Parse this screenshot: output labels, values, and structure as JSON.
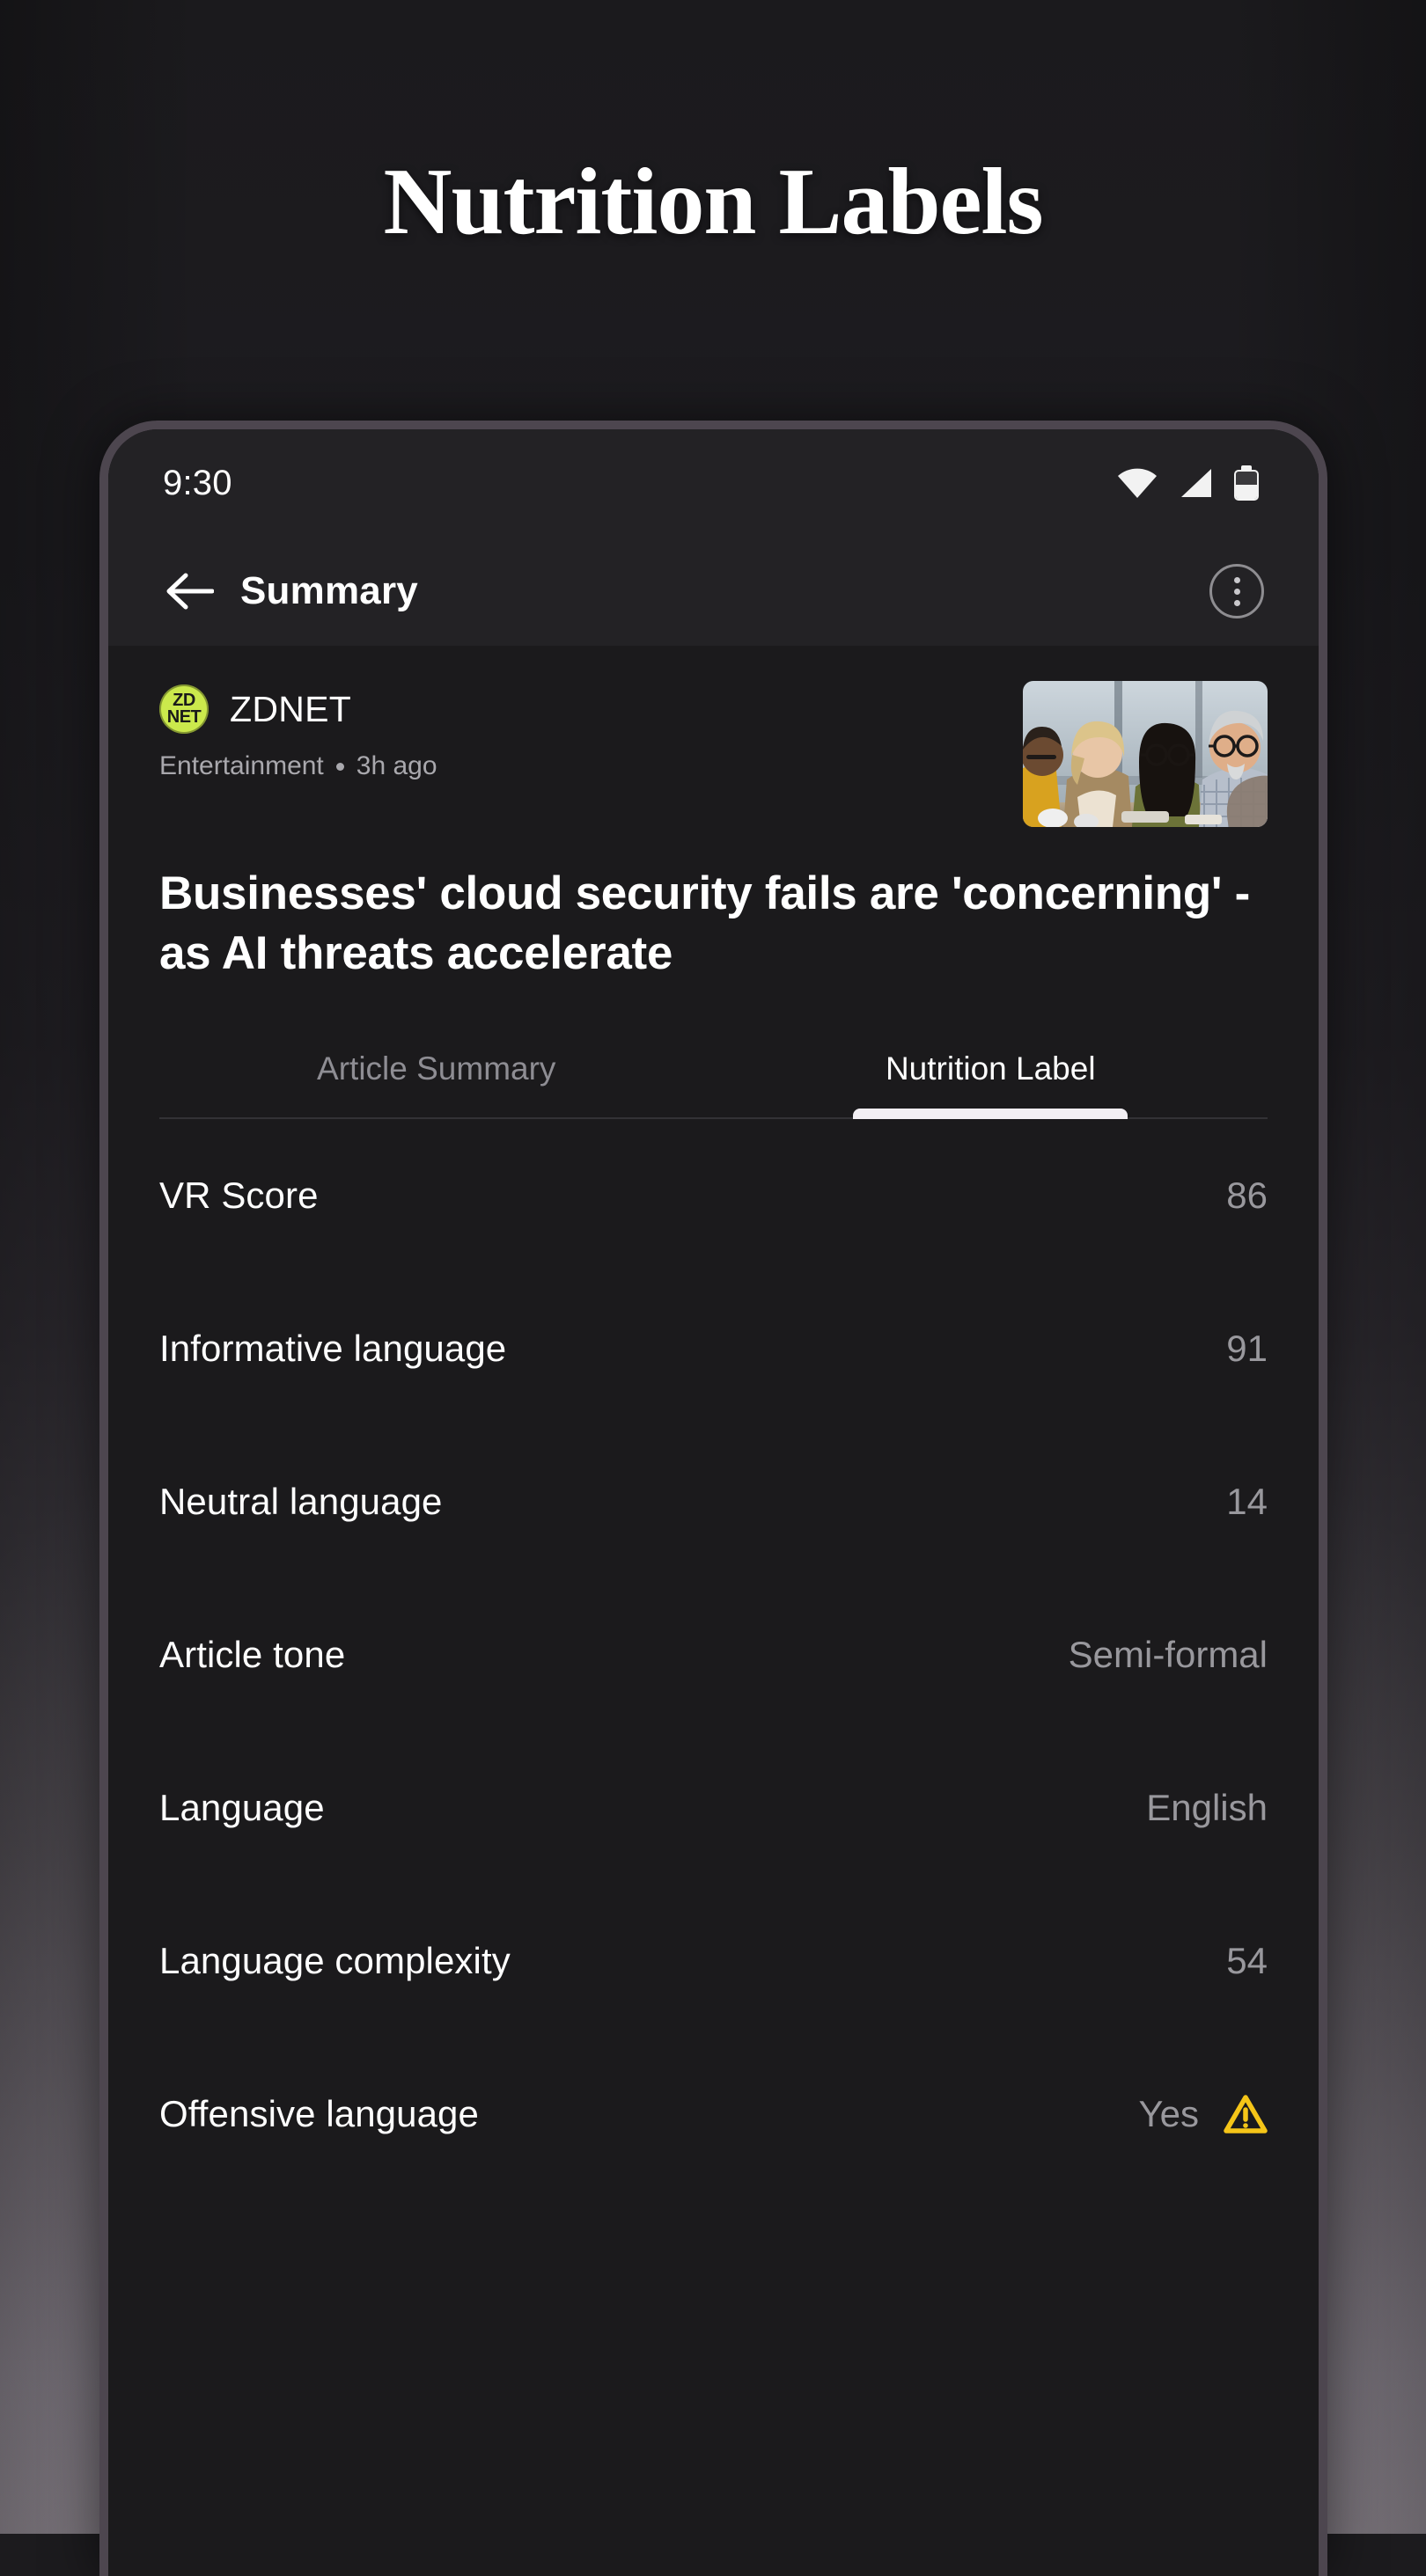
{
  "page": {
    "heading": "Nutrition Labels",
    "background_top_color": "#1b1a1d",
    "background_bottom_color": "#878088",
    "phone_bezel_color": "#4d464f"
  },
  "status_bar": {
    "time": "9:30",
    "icons": [
      "wifi-icon",
      "cellular-signal-icon",
      "battery-icon"
    ]
  },
  "app_bar": {
    "back_icon": "back-arrow-icon",
    "title": "Summary",
    "overflow_icon": "more-vertical-icon"
  },
  "article": {
    "source": {
      "logo_line1": "ZD",
      "logo_line2": "NET",
      "logo_color": "#cbe94c",
      "name": "ZDNET"
    },
    "category": "Entertainment",
    "time_ago": "3h ago",
    "headline": "Businesses' cloud security fails are 'concerning' - as AI threats accelerate",
    "thumbnail_alt": "business-meeting-photo"
  },
  "tabs": [
    {
      "label": "Article Summary",
      "active": false
    },
    {
      "label": "Nutrition Label",
      "active": true
    }
  ],
  "nutrition_label": {
    "rows": [
      {
        "label": "VR Score",
        "value": "86",
        "warning": false
      },
      {
        "label": "Informative language",
        "value": "91",
        "warning": false
      },
      {
        "label": "Neutral language",
        "value": "14",
        "warning": false
      },
      {
        "label": "Article tone",
        "value": "Semi-formal",
        "warning": false
      },
      {
        "label": "Language",
        "value": "English",
        "warning": false
      },
      {
        "label": "Language complexity",
        "value": "54",
        "warning": false
      },
      {
        "label": "Offensive language",
        "value": "Yes",
        "warning": true,
        "warning_color": "#f5c518"
      }
    ]
  }
}
